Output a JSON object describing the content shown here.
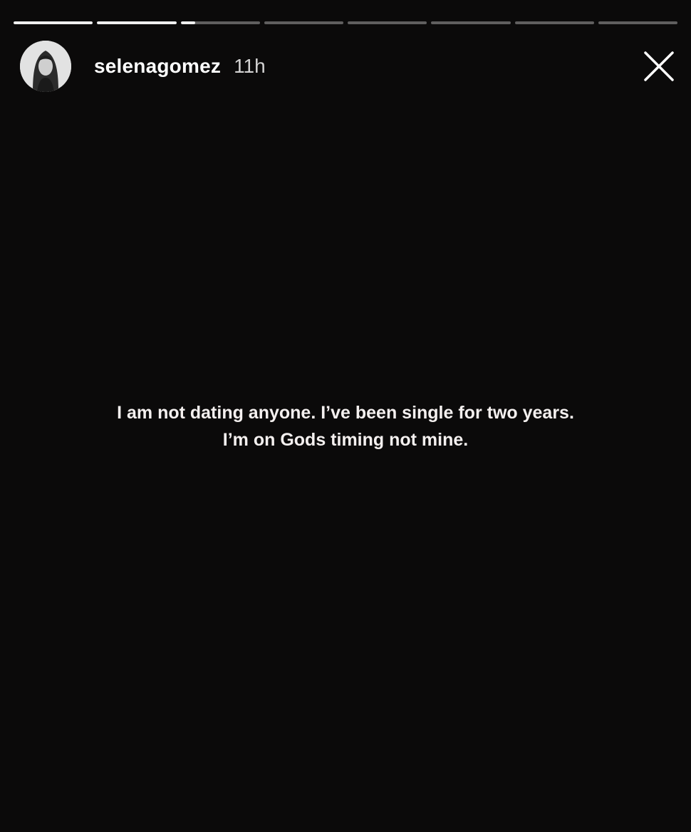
{
  "story": {
    "segments": [
      {
        "progress": 1.0
      },
      {
        "progress": 1.0
      },
      {
        "progress": 0.18
      },
      {
        "progress": 0
      },
      {
        "progress": 0
      },
      {
        "progress": 0
      },
      {
        "progress": 0
      },
      {
        "progress": 0
      }
    ],
    "user": {
      "username": "selenagomez",
      "time_ago": "11h",
      "avatar_icon": "profile-photo"
    },
    "close_icon": "close-icon",
    "text_lines": [
      "I am not dating anyone. I’ve been single for two years.",
      "I’m on Gods timing not mine."
    ],
    "colors": {
      "background": "#0b0a0a",
      "text": "#f4f0ef"
    }
  }
}
